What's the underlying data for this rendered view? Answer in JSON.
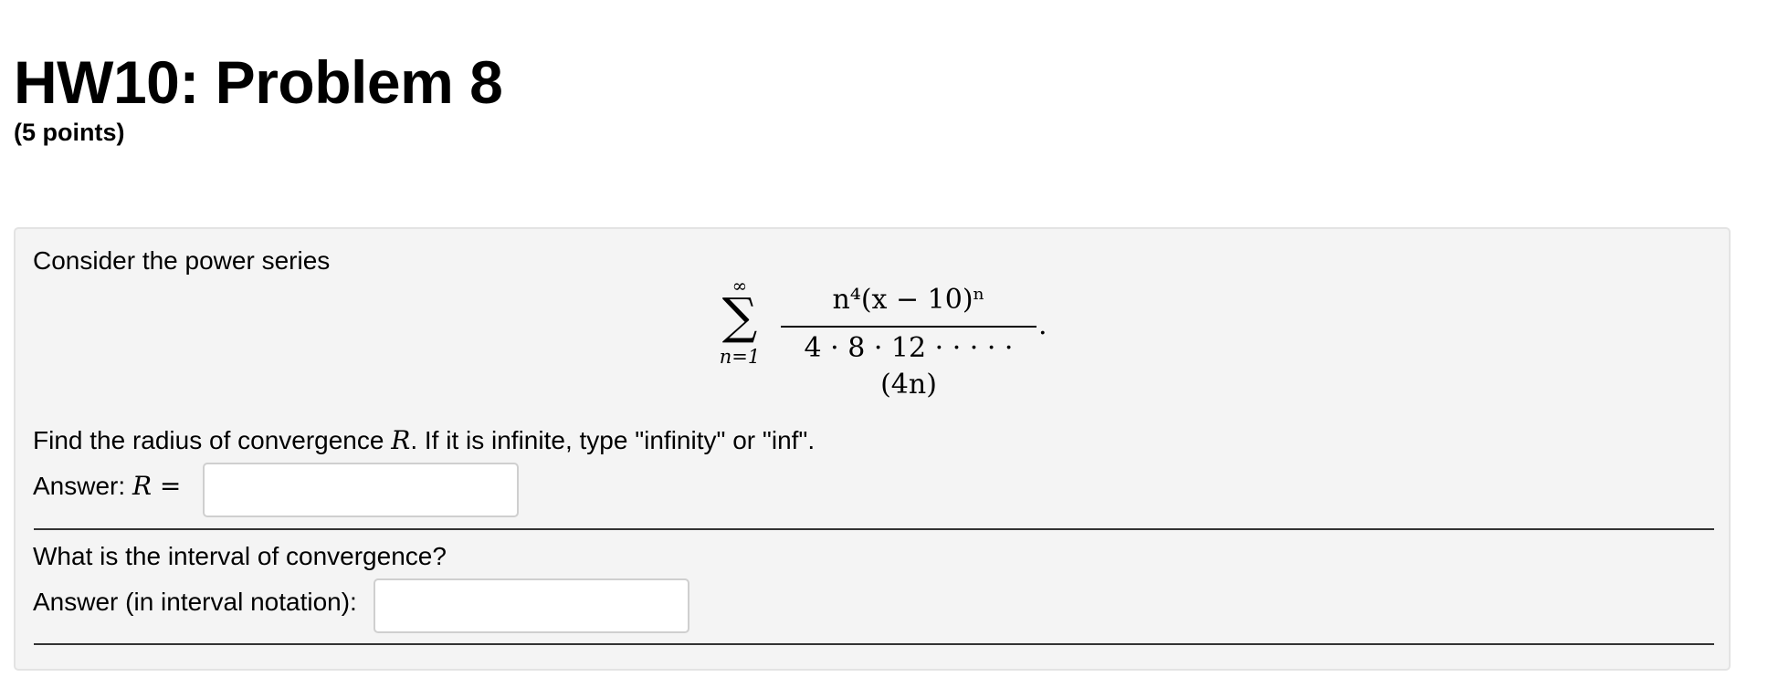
{
  "problem": {
    "title": "HW10: Problem 8",
    "points": "(5 points)"
  },
  "body": {
    "intro": "Consider the power series",
    "formula": {
      "sum_upper": "∞",
      "sum_symbol": "∑",
      "sum_lower": "n=1",
      "numerator": "n⁴(x − 10)ⁿ",
      "denominator": "4 · 8 · 12 · · · · · (4n)",
      "trailing": "."
    },
    "part1": {
      "question_before": "Find the radius of convergence ",
      "question_var": "R",
      "question_after": ". If it is infinite, type \"infinity\" or \"inf\".",
      "answer_label": "Answer: ",
      "answer_var": "R",
      "answer_eq": " =",
      "answer_value": ""
    },
    "part2": {
      "question": "What is the interval of convergence?",
      "answer_label": "Answer (in interval notation):",
      "answer_value": ""
    }
  }
}
